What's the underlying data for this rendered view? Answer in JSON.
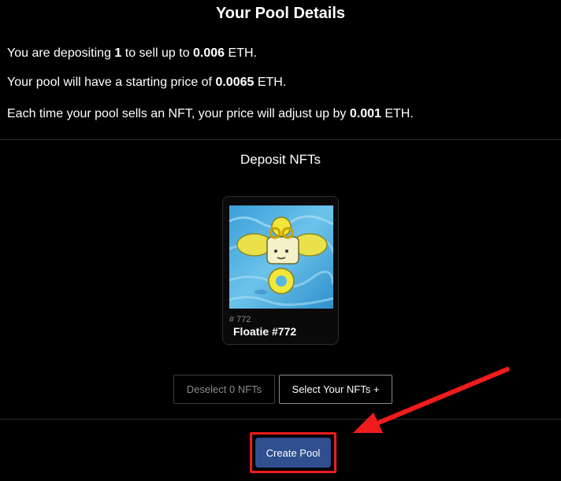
{
  "header": {
    "title": "Your Pool Details"
  },
  "details": {
    "line1": {
      "prefix": "You are depositing ",
      "amount": "1",
      "mid": " to sell up to ",
      "value": "0.006",
      "suffix": " ETH."
    },
    "line2": {
      "prefix": "Your pool will have a starting price of ",
      "value": "0.0065",
      "suffix": " ETH."
    },
    "line3": {
      "prefix": "Each time your pool sells an NFT, your price will adjust up by ",
      "value": "0.001",
      "suffix": " ETH."
    }
  },
  "deposit": {
    "title": "Deposit NFTs",
    "nfts": [
      {
        "token_id": "# 772",
        "name": "Floatie #772"
      }
    ]
  },
  "actions": {
    "deselect_label": "Deselect 0 NFTs",
    "select_label": "Select Your NFTs +",
    "create_label": "Create Pool"
  },
  "annotation": {
    "highlight_color": "#ee1c1c"
  },
  "colors": {
    "primary_button": "#2f4f8f",
    "background": "#000000"
  }
}
